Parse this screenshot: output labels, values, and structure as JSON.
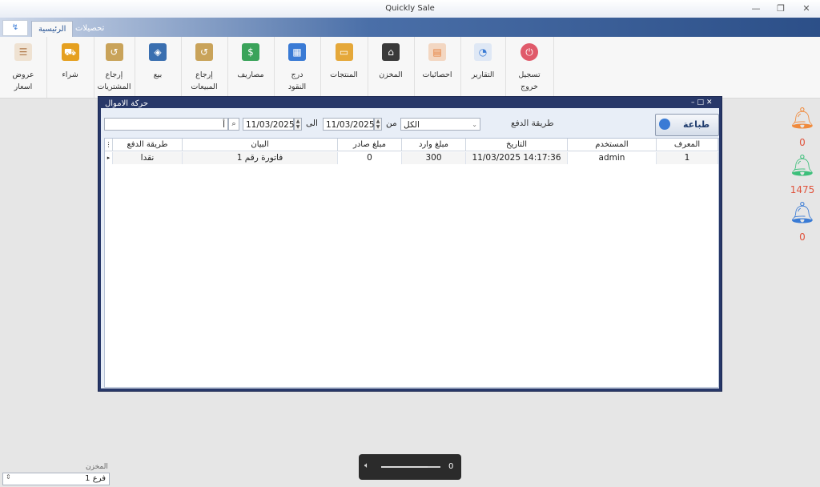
{
  "window": {
    "title": "Quickly Sale",
    "controls": [
      "minimize-icon",
      "restore-icon",
      "close-icon"
    ]
  },
  "tabs": {
    "quick_access": "↯",
    "main": "الرئيسية",
    "collections": "تحصيلات"
  },
  "ribbon": {
    "buttons": [
      {
        "id": "logout",
        "label_1": "تسجيل",
        "label_2": "خروج",
        "icon": "power-icon",
        "color": "#e05a6a"
      },
      {
        "id": "reports",
        "label_1": "التقارير",
        "label_2": "",
        "icon": "reports-icon",
        "color": "#4c8bd6"
      },
      {
        "id": "stats",
        "label_1": "احصائيات",
        "label_2": "",
        "icon": "stats-chart-icon",
        "color": "#e67e3a"
      },
      {
        "id": "store",
        "label_1": "المخزن",
        "label_2": "",
        "icon": "warehouse-icon",
        "color": "#333333"
      },
      {
        "id": "products",
        "label_1": "المنتجات",
        "label_2": "",
        "icon": "products-box-icon",
        "color": "#e5a83a"
      },
      {
        "id": "cashdrawer",
        "label_1": "درج",
        "label_2": "النقود",
        "icon": "cash-drawer-icon",
        "color": "#3a7bd5"
      },
      {
        "id": "expenses",
        "label_1": "مصاريف",
        "label_2": "",
        "icon": "money-icon",
        "color": "#3aa35a"
      },
      {
        "id": "sales_return",
        "label_1": "إرجاع",
        "label_2": "المبيعات",
        "icon": "return-box-icon",
        "color": "#c9a35a"
      },
      {
        "id": "sell",
        "label_1": "بيع",
        "label_2": "",
        "icon": "price-tag-icon",
        "color": "#3a6fb0"
      },
      {
        "id": "purchase_return",
        "label_1": "إرجاع",
        "label_2": "المشتريات",
        "icon": "return-box-icon",
        "color": "#c9a35a"
      },
      {
        "id": "buy",
        "label_1": "شراء",
        "label_2": "",
        "icon": "shopping-cart-icon",
        "color": "#e5a020"
      },
      {
        "id": "offers",
        "label_1": "عروض",
        "label_2": "اسعار",
        "icon": "price-list-icon",
        "color": "#d9b48a"
      }
    ]
  },
  "notifications": [
    {
      "count": "0",
      "color": "#f08a3c",
      "icon": "bell-orange-icon"
    },
    {
      "count": "1475",
      "color": "#3cbf7a",
      "icon": "bell-green-icon"
    },
    {
      "count": "0",
      "color": "#3a7bd5",
      "icon": "bell-blue-icon"
    }
  ],
  "dialog": {
    "title": "حركة الاموال",
    "print_label": "طباعة",
    "payment_method_label": "طريقة الدفع",
    "payment_method_value": "الكل",
    "from_label": "من",
    "to_label": "الى",
    "from_date": "11/03/2025",
    "to_date": "11/03/2025",
    "search_value": "أ",
    "columns": [
      "المعرف",
      "المستخدم",
      "التاريخ",
      "مبلغ وارد",
      "مبلغ صادر",
      "البيان",
      "طريقة الدفع"
    ],
    "rows": [
      {
        "id": "1",
        "user": "admin",
        "date": "11/03/2025 14:17:36",
        "in": "300",
        "out": "0",
        "desc": "فاتورة رقم 1",
        "method": "نقدا"
      }
    ]
  },
  "branch": {
    "label": "المخزن",
    "value": "فرع 1"
  },
  "volume": {
    "value": "0",
    "level": 0.78
  }
}
